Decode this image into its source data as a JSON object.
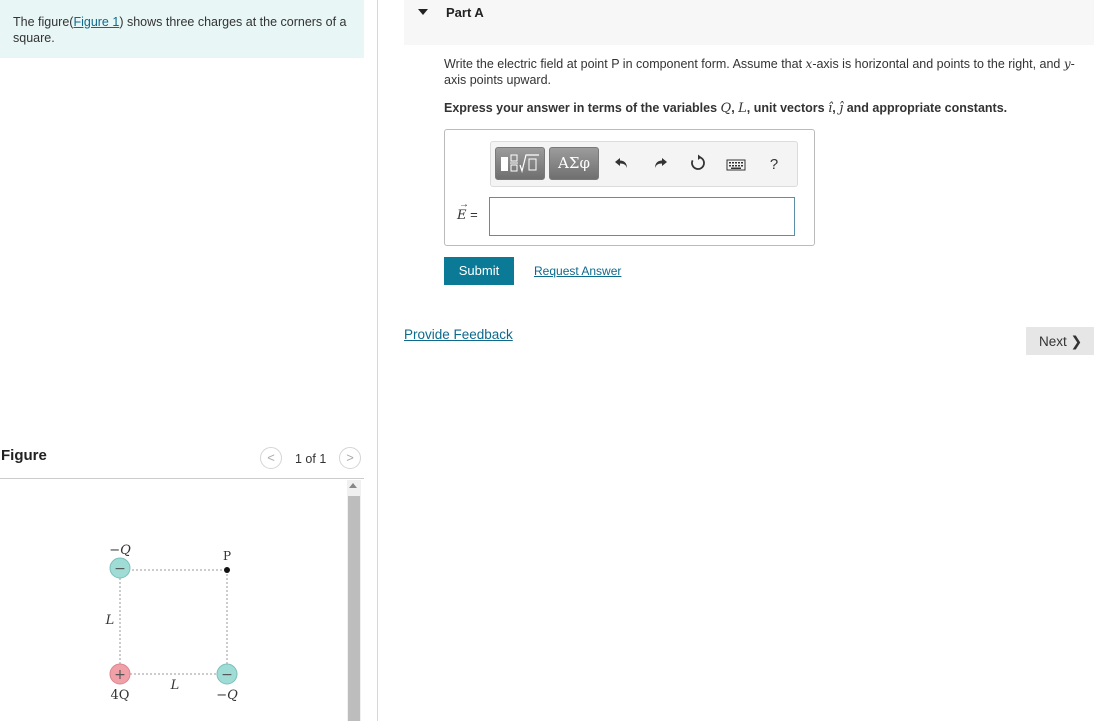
{
  "intro": {
    "prefix": "The figure(",
    "link": "Figure 1",
    "suffix": ") shows three charges at the corners of a square."
  },
  "figure_panel": {
    "title": "Figure",
    "prev_glyph": "<",
    "next_glyph": ">",
    "count": "1 of 1",
    "diagram": {
      "top_left_label": "−Q",
      "top_left_sign": "−",
      "point_label": "P",
      "side_label_left": "L",
      "bottom_left_sign": "+",
      "bottom_left_label": "4Q",
      "side_label_bottom": "L",
      "bottom_right_sign": "−",
      "bottom_right_label": "−Q",
      "negative_fill": "#9fdcd6",
      "positive_fill": "#f2a0a8"
    }
  },
  "part": {
    "title": "Part A",
    "question_a": "Write the electric field at point P in component form. Assume that ",
    "question_x": "x",
    "question_b": "-axis is horizontal and points to the right, and ",
    "question_y": "y",
    "question_c": "-axis points upward.",
    "instruction_a": "Express your answer in terms of the variables ",
    "var_q": "Q",
    "comma": ", ",
    "var_l": "L",
    "instruction_b": ", unit vectors ",
    "var_i": "î",
    "var_j": "ĵ",
    "instruction_c": " and appropriate constants."
  },
  "toolbar": {
    "greek_label": "ΑΣφ",
    "undo_icon": "undo-icon",
    "redo_icon": "redo-icon",
    "reset_icon": "reset-icon",
    "keyboard_icon": "keyboard-icon",
    "help_label": "?"
  },
  "answer": {
    "label_var": "E",
    "label_eq": " =",
    "value": ""
  },
  "actions": {
    "submit": "Submit",
    "request": "Request Answer",
    "feedback": "Provide Feedback",
    "next": "Next",
    "next_glyph": "❯"
  },
  "colors": {
    "accent": "#0b7a96",
    "link": "#0d6a8c",
    "intro_bg": "#e8f6f6"
  }
}
